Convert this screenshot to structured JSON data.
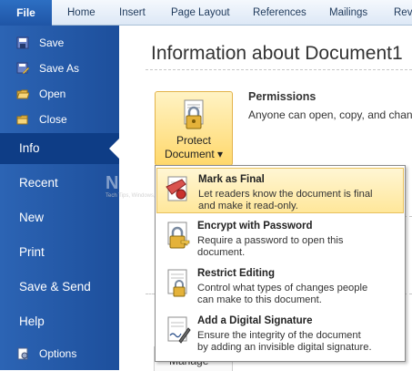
{
  "ribbon": {
    "file_tab": "File",
    "tabs": [
      "Home",
      "Insert",
      "Page Layout",
      "References",
      "Mailings",
      "Rev"
    ]
  },
  "backstage": {
    "commands": [
      "Save",
      "Save As",
      "Open",
      "Close"
    ],
    "nav": [
      "Info",
      "Recent",
      "New",
      "Print",
      "Save & Send",
      "Help",
      "Options"
    ],
    "selected": "Info"
  },
  "info": {
    "title": "Information about Document1",
    "protect_button": {
      "line1": "Protect",
      "line2": "Document ▾"
    },
    "permissions": {
      "title": "Permissions",
      "desc": "Anyone can open, copy, and chan"
    },
    "behind_text": "Manage"
  },
  "watermark": {
    "text": "NIRMAL.COM",
    "sub": "Tech Tips, Windows, Office and more"
  },
  "menu": {
    "items": [
      {
        "title": "Mark as Final",
        "desc": [
          "Let readers know the document is final",
          "and make it read-only."
        ],
        "icon": "mark-final-icon"
      },
      {
        "title": "Encrypt with Password",
        "desc": [
          "Require a password to open this",
          "document."
        ],
        "icon": "encrypt-lock-icon"
      },
      {
        "title": "Restrict Editing",
        "desc": [
          "Control what types of changes people",
          "can make to this document."
        ],
        "icon": "restrict-editing-icon"
      },
      {
        "title": "Add a Digital Signature",
        "desc": [
          "Ensure the integrity of the document",
          "by adding an invisible digital signature."
        ],
        "icon": "digital-signature-icon"
      }
    ]
  },
  "colors": {
    "accent": "#2a62b2",
    "highlight": "#ffe79a"
  }
}
